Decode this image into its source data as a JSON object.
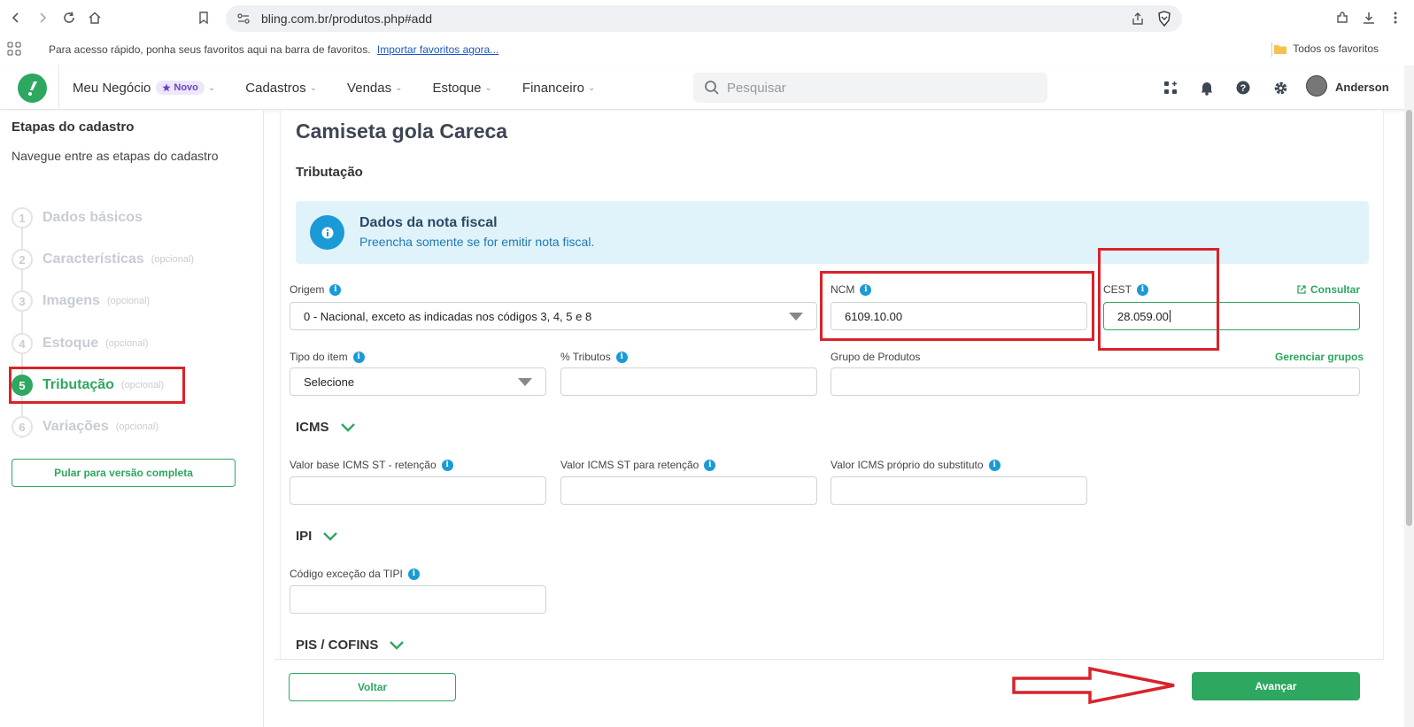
{
  "browser": {
    "url": "bling.com.br/produtos.php#add",
    "bookmarks_hint": "Para acesso rápido, ponha seus favoritos aqui na barra de favoritos.",
    "bookmarks_import": "Importar favoritos agora...",
    "all_bookmarks": "Todos os favoritos"
  },
  "header": {
    "menu": [
      {
        "label": "Meu Negócio"
      },
      {
        "label": "Cadastros"
      },
      {
        "label": "Vendas"
      },
      {
        "label": "Estoque"
      },
      {
        "label": "Financeiro"
      }
    ],
    "new_badge": "Novo",
    "search_placeholder": "Pesquisar",
    "user_name": "Anderson"
  },
  "sidebar": {
    "title": "Etapas do cadastro",
    "subtitle": "Navegue entre as etapas do cadastro",
    "steps": [
      {
        "num": "1",
        "label": "Dados básicos",
        "optional": ""
      },
      {
        "num": "2",
        "label": "Características",
        "optional": "(opcional)"
      },
      {
        "num": "3",
        "label": "Imagens",
        "optional": "(opcional)"
      },
      {
        "num": "4",
        "label": "Estoque",
        "optional": "(opcional)"
      },
      {
        "num": "5",
        "label": "Tributação",
        "optional": "(opcional)"
      },
      {
        "num": "6",
        "label": "Variações",
        "optional": "(opcional)"
      }
    ],
    "active_step": "5",
    "skip_button": "Pular para versão completa"
  },
  "main": {
    "product_title": "Camiseta gola Careca",
    "section": "Tributação",
    "info": {
      "title": "Dados da nota fiscal",
      "subtitle": "Preencha somente se for emitir nota fiscal."
    },
    "fields": {
      "origem_label": "Origem",
      "origem_value": "0 - Nacional, exceto as indicadas nos códigos 3, 4, 5 e 8",
      "ncm_label": "NCM",
      "ncm_value": "6109.10.00",
      "cest_label": "CEST",
      "cest_value": "28.059.00",
      "consultar": "Consultar",
      "tipo_label": "Tipo do item",
      "tipo_value": "Selecione",
      "tributos_label": "% Tributos",
      "grupo_label": "Grupo de Produtos",
      "gerenciar": "Gerenciar grupos"
    },
    "icms": {
      "title": "ICMS",
      "base_label": "Valor base ICMS ST - retenção",
      "st_label": "Valor ICMS ST para retenção",
      "proprio_label": "Valor ICMS próprio do substituto"
    },
    "ipi": {
      "title": "IPI",
      "tipi_label": "Código exceção da TIPI"
    },
    "pis": {
      "title": "PIS / COFINS"
    }
  },
  "footer": {
    "back": "Voltar",
    "next": "Avançar"
  },
  "colors": {
    "brand_green": "#2ea760",
    "info_blue": "#1a9ad6",
    "annotation_red": "#d8232a"
  }
}
